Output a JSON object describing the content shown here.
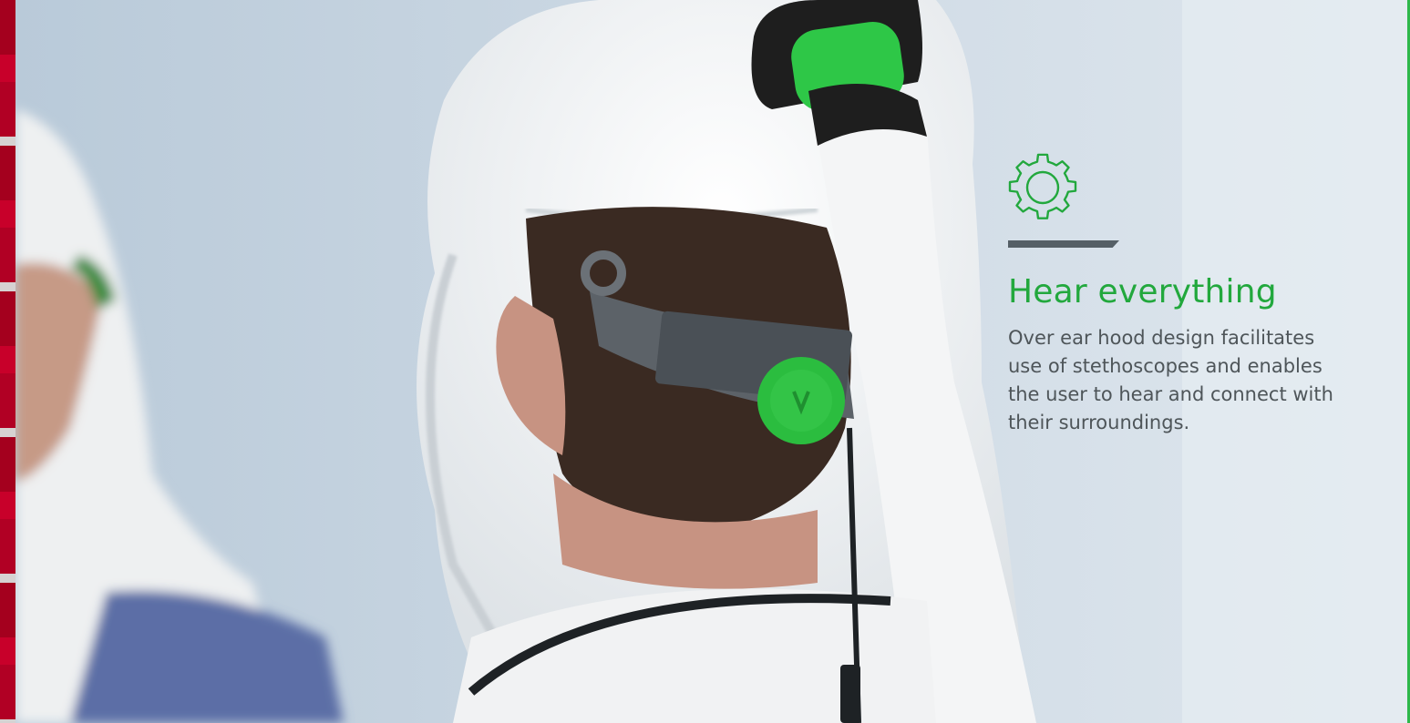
{
  "feature": {
    "icon": "gear-icon",
    "title": "Hear everything",
    "description": "Over ear hood design facilitates use of stethoscopes and enables the user to hear and connect with their surroundings."
  },
  "colors": {
    "accent": "#22a83d",
    "text": "#4e5559",
    "divider": "#555f66",
    "left_edge": "#b10024"
  }
}
